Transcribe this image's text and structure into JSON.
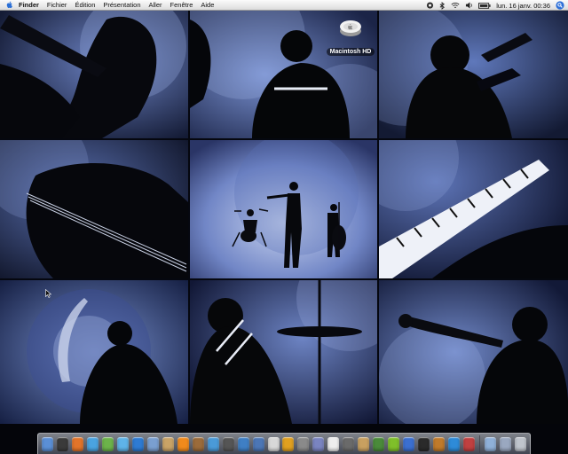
{
  "menubar": {
    "app_name": "Finder",
    "items": [
      "Fichier",
      "Édition",
      "Présentation",
      "Aller",
      "Fenêtre",
      "Aide"
    ],
    "clock": "lun. 16 janv. 00:36",
    "status_icons": [
      "ichat-icon",
      "bluetooth-icon",
      "wifi-icon",
      "volume-icon",
      "battery-icon"
    ]
  },
  "desktop": {
    "icons": [
      {
        "label": "Macintosh HD",
        "icon": "hard-drive-icon"
      }
    ]
  },
  "dock": {
    "apps": [
      {
        "icon": "finder-icon",
        "color": "#5b8fd6"
      },
      {
        "icon": "dashboard-icon",
        "color": "#3a3a3a"
      },
      {
        "icon": "firefox-icon",
        "color": "#e2742a"
      },
      {
        "icon": "safari-icon",
        "color": "#4aa3e0"
      },
      {
        "icon": "adium-icon",
        "color": "#6cb34a"
      },
      {
        "icon": "ichat-icon",
        "color": "#5fb3e8"
      },
      {
        "icon": "address-book-icon",
        "color": "#2e7bd3"
      },
      {
        "icon": "mail-icon",
        "color": "#7a9fd0"
      },
      {
        "icon": "iphoto-icon",
        "color": "#c9a366"
      },
      {
        "icon": "vlc-icon",
        "color": "#f08a1c"
      },
      {
        "icon": "photo-icon",
        "color": "#9b6b3a"
      },
      {
        "icon": "itunes-icon",
        "color": "#4a9ad8"
      },
      {
        "icon": "imovie-icon",
        "color": "#555555"
      },
      {
        "icon": "iphoto-book-icon",
        "color": "#3f7fc4"
      },
      {
        "icon": "preview-icon",
        "color": "#4c76b5"
      },
      {
        "icon": "clock-icon",
        "color": "#d8d8d8"
      },
      {
        "icon": "camino-icon",
        "color": "#e0a020"
      },
      {
        "icon": "system-prefs-icon",
        "color": "#8a8a8a"
      },
      {
        "icon": "script-editor-icon",
        "color": "#7a84c0"
      },
      {
        "icon": "textedit-icon",
        "color": "#eeeeee"
      },
      {
        "icon": "printer-icon",
        "color": "#6a6a6a"
      },
      {
        "icon": "garageband-icon",
        "color": "#c8a060"
      },
      {
        "icon": "activity-monitor-icon",
        "color": "#4a8a3a"
      },
      {
        "icon": "frontrow-icon",
        "color": "#7fbf2a"
      },
      {
        "icon": "network-icon",
        "color": "#3b6fd0"
      },
      {
        "icon": "terminal-icon",
        "color": "#2a2a2a"
      },
      {
        "icon": "quicktime-icon",
        "color": "#c07a2a"
      },
      {
        "icon": "azureus-icon",
        "color": "#2e8bd8"
      },
      {
        "icon": "photobooth-icon",
        "color": "#c04040"
      }
    ],
    "docs": [
      {
        "icon": "folder-icon",
        "color": "#8fb0d8"
      },
      {
        "icon": "applications-icon",
        "color": "#9aa8c0"
      },
      {
        "icon": "trash-icon",
        "color": "#bfc4cc"
      }
    ]
  }
}
